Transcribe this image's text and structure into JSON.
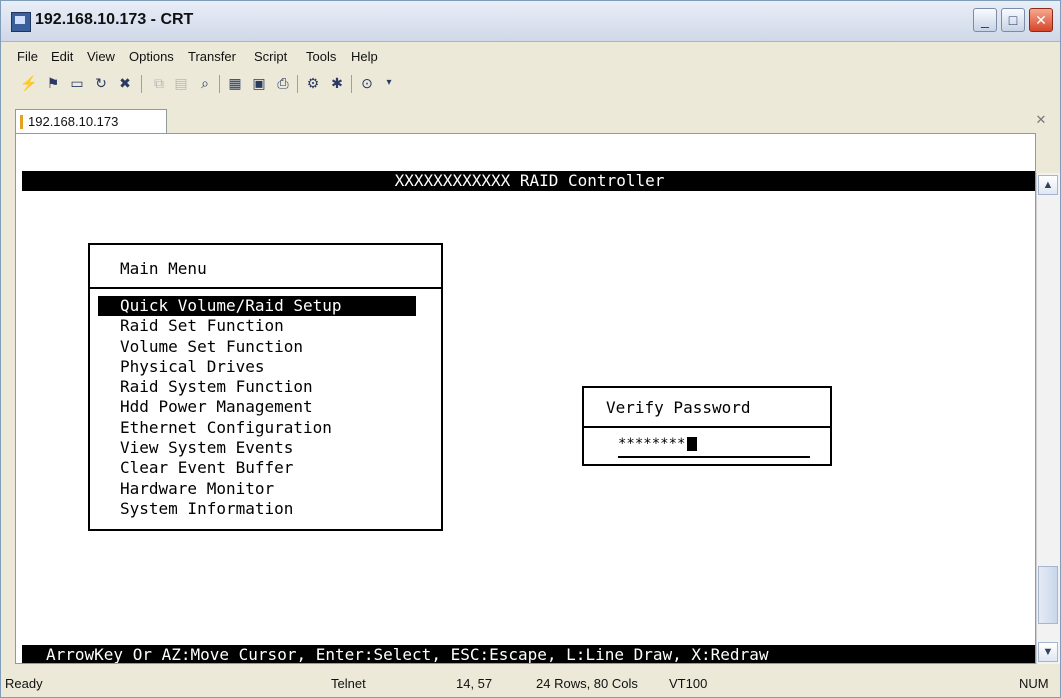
{
  "window": {
    "title": "192.168.10.173 - CRT"
  },
  "menubar": {
    "items": [
      "File",
      "Edit",
      "View",
      "Options",
      "Transfer",
      "Script",
      "Tools",
      "Help"
    ]
  },
  "toolbar": {
    "tools": [
      "connect-icon",
      "quick-connect-icon",
      "connect-tab-icon",
      "reconnect-icon",
      "disconnect-icon",
      "copy-icon",
      "paste-icon",
      "find-icon",
      "print-setup-icon",
      "print-icon",
      "print-screen-icon",
      "session-options-icon",
      "global-options-icon",
      "help-icon"
    ]
  },
  "tabs": [
    {
      "label": "192.168.10.173",
      "active": true
    }
  ],
  "terminal": {
    "header": "XXXXXXXXXXXX RAID Controller",
    "main_menu": {
      "title": "Main Menu",
      "items": [
        "Quick Volume/Raid Setup",
        "Raid Set Function",
        "Volume Set Function",
        "Physical Drives",
        "Raid System Function",
        "Hdd Power Management",
        "Ethernet Configuration",
        "View System Events",
        "Clear Event Buffer",
        "Hardware Monitor",
        "System Information"
      ],
      "selected_index": 0
    },
    "password_dialog": {
      "title": "Verify Password",
      "value": "********"
    },
    "footer": "ArrowKey Or AZ:Move Cursor, Enter:Select, ESC:Escape, L:Line Draw, X:Redraw"
  },
  "statusbar": {
    "state": "Ready",
    "protocol": "Telnet",
    "cursor": "14, 57",
    "size": "24 Rows, 80 Cols",
    "emulation": "VT100",
    "num": "NUM"
  }
}
